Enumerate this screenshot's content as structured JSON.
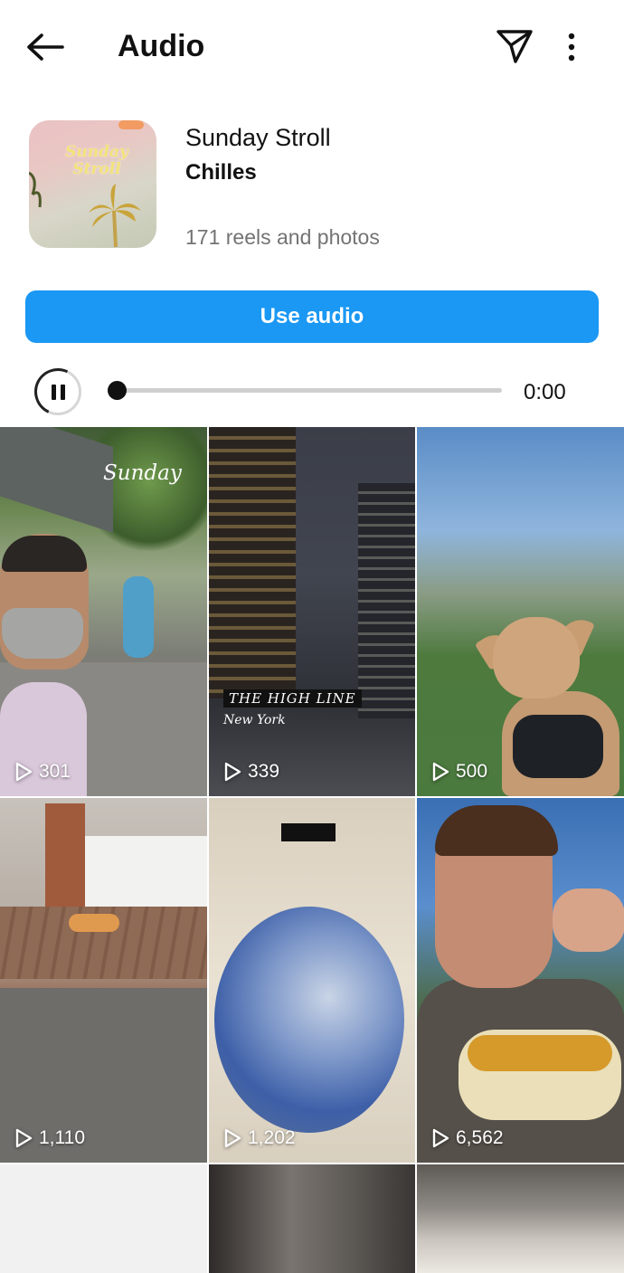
{
  "header": {
    "title": "Audio",
    "icons": {
      "back": "arrow-left-icon",
      "share": "paper-plane-icon",
      "more": "more-vertical-icon"
    }
  },
  "track": {
    "title": "Sunday Stroll",
    "artist": "Chilles",
    "count_label": "171 reels and photos",
    "cover_text": "Sunday Stroll"
  },
  "use_audio": {
    "label": "Use audio"
  },
  "player": {
    "state": "playing",
    "time": "0:00",
    "progress": 0
  },
  "grid": {
    "tiles": [
      {
        "views": "301",
        "art_text": "Sunday"
      },
      {
        "views": "339",
        "caption": "THE HIGH LINE",
        "subcaption": "New York"
      },
      {
        "views": "500"
      },
      {
        "views": "1,110"
      },
      {
        "views": "1,202"
      },
      {
        "views": "6,562"
      },
      {
        "views": ""
      },
      {
        "views": ""
      },
      {
        "views": ""
      }
    ]
  },
  "colors": {
    "accent": "#1a98f3",
    "text": "#111111",
    "muted": "#737373",
    "divider": "#cfcfcf"
  }
}
